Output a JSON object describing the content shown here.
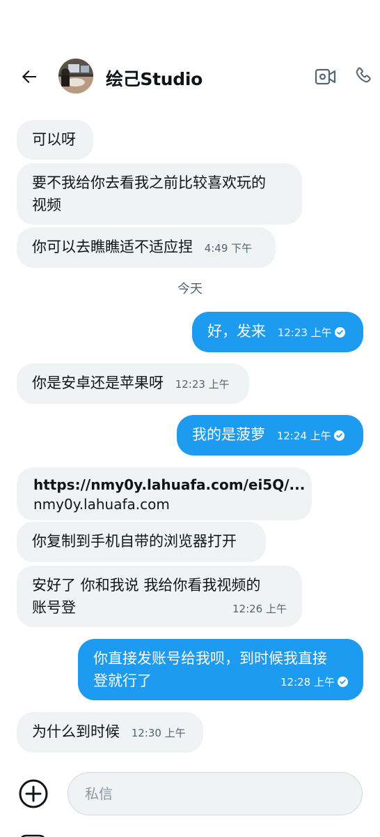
{
  "header": {
    "contact_name": "绘己Studio",
    "back_icon": "arrow-left-icon",
    "video_icon": "video-call-icon",
    "call_icon": "phone-icon"
  },
  "messages": [
    {
      "dir": "in",
      "text": "可以呀",
      "time": ""
    },
    {
      "dir": "in",
      "lines": [
        "要不我给你去看我之前比较喜欢玩的",
        "视频"
      ],
      "time": ""
    },
    {
      "dir": "in",
      "text": "你可以去瞧瞧适不适应捏",
      "time": "4:49 下午"
    },
    {
      "dir": "out",
      "text": "好，发来",
      "time": "12:23 上午",
      "read": true
    },
    {
      "dir": "in",
      "text": "你是安卓还是苹果呀",
      "time": "12:23 上午"
    },
    {
      "dir": "out",
      "text": "我的是菠萝",
      "time": "12:24 上午",
      "read": true
    },
    {
      "dir": "in",
      "link_url": "https://nmy0y.lahuafa.com/ei5Q/...",
      "link_domain": "nmy0y.lahuafa.com",
      "time": ""
    },
    {
      "dir": "in",
      "text": "你复制到手机自带的浏览器打开",
      "time": ""
    },
    {
      "dir": "in",
      "lines": [
        "安好了 你和我说 我给你看我视频的",
        "账号登"
      ],
      "time": "12:26 上午"
    },
    {
      "dir": "out",
      "lines": [
        "你直接发账号给我呗，到时候我直接",
        "登就行了"
      ],
      "time": "12:28 上午",
      "read": true
    },
    {
      "dir": "in",
      "text": "为什么到时候",
      "time": "12:30 上午"
    }
  ],
  "day_separator": "今天",
  "composer": {
    "placeholder": "私信",
    "value": "",
    "add_icon": "plus-circle-icon"
  },
  "colors": {
    "outgoing_bubble": "#1d9bf0",
    "incoming_bubble": "#eff3f4",
    "timestamp": "#536471"
  }
}
